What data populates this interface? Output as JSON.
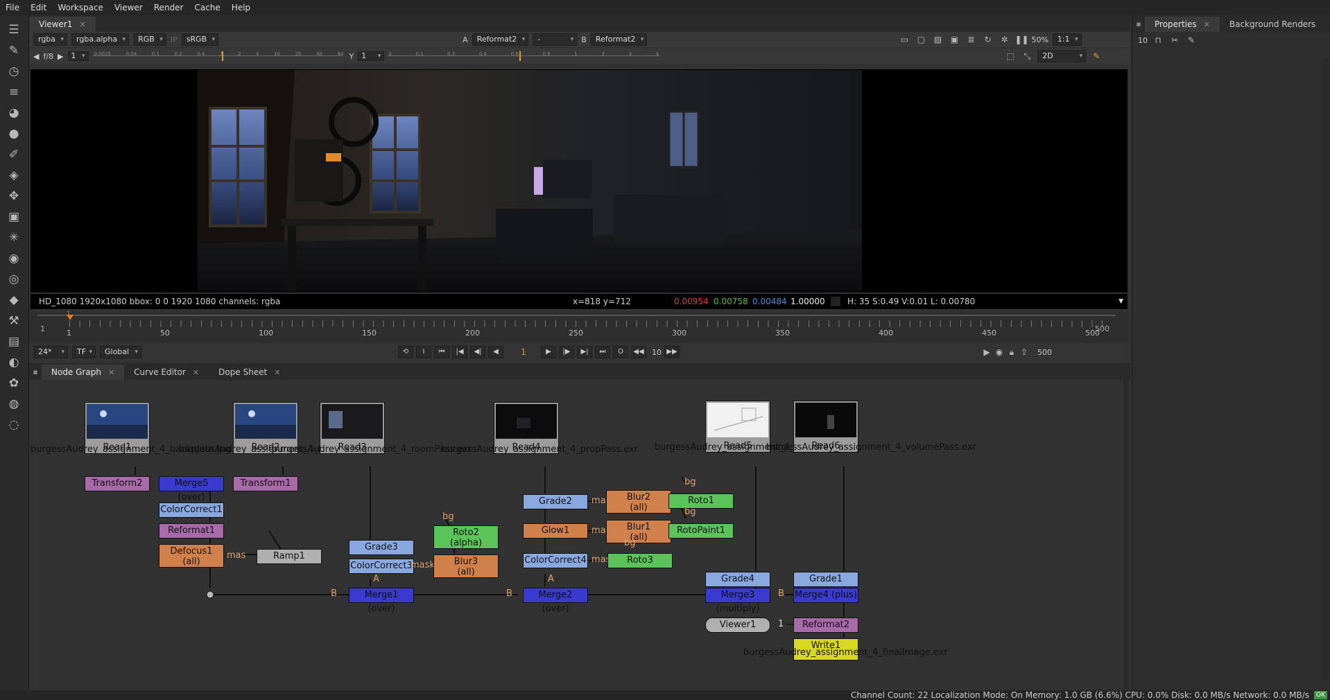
{
  "menu": [
    "File",
    "Edit",
    "Workspace",
    "Viewer",
    "Render",
    "Cache",
    "Help"
  ],
  "toolbar_icons": [
    "viewer-icon",
    "paint-icon",
    "time-icon",
    "channel-icon",
    "color-icon",
    "filter-icon",
    "draw-icon",
    "layers-icon",
    "transform-icon",
    "3d-icon",
    "particles-icon",
    "deep-icon",
    "views-icon",
    "metadata-icon",
    "toolsets-icon",
    "other-icon",
    "furnace-icon",
    "ocula-icon",
    "cara-icon",
    "ofx-icon",
    "nukex-icon"
  ],
  "viewer": {
    "tab": "Viewer1",
    "row1": {
      "layer": "rgba",
      "channel": "rgba.alpha",
      "display": "RGB",
      "ip": "IP",
      "lut": "sRGB",
      "a_label": "A",
      "a_input": "Reformat2",
      "a_op": "-",
      "b_label": "B",
      "b_input": "Reformat2",
      "zoom": "50%",
      "ratio": "1:1"
    },
    "row2": {
      "fstop": "f/8",
      "gain": "1",
      "y_label": "Y",
      "gamma": "1",
      "mode": "2D",
      "gain_ticks": [
        "0.0025",
        "0.04",
        "0.1",
        "0.2",
        "0.4",
        "1",
        "2",
        "4",
        "10",
        "20",
        "40",
        "64"
      ],
      "gamma_ticks": [
        "0",
        "0.1",
        "0.2",
        "0.4",
        "0.6",
        "0.8",
        "1",
        "2",
        "3",
        "4"
      ]
    },
    "info_left": "HD_1080 1920x1080  bbox: 0 0 1920 1080 channels: rgba",
    "info_coords": "x=818 y=712",
    "info_r": "0.00954",
    "info_g": "0.00758",
    "info_b": "0.00484",
    "info_a": "1.00000",
    "info_hsv": "H: 35 S:0.49 V:0.01  L: 0.00780",
    "colors": {
      "r": "#e04040",
      "g": "#60c040",
      "b": "#5090e0",
      "a": "#eeeeee"
    }
  },
  "timeline": {
    "start": "1",
    "end": "500",
    "ticks": [
      "1",
      "50",
      "100",
      "150",
      "200",
      "250",
      "300",
      "350",
      "400",
      "450",
      "500"
    ],
    "current_marker": "1"
  },
  "playbar": {
    "fps": "24*",
    "tf": "TF",
    "scope": "Global",
    "frame": "1",
    "step": "10",
    "end_frame": "500"
  },
  "nodegraph": {
    "tabs": [
      "Node Graph",
      "Curve Editor",
      "Dope Sheet"
    ],
    "reads": [
      {
        "name": "Read1",
        "file": "burgessAudrey_assignment_4_backplate.jpg"
      },
      {
        "name": "Read2",
        "file": "burgessAudrey_assignment_4_backplate.jpg"
      },
      {
        "name": "Read3",
        "file": "burgessAudrey_assignment_4_roomPass.exr"
      },
      {
        "name": "Read4",
        "file": "burgessAudrey_assignment_4_propPass.exr"
      },
      {
        "name": "Read5",
        "file": "burgessAudrey_assignment_4_AOPass.exr"
      },
      {
        "name": "Read6",
        "file": "burgessAudrey_assignment_4_volumePass.exr"
      }
    ],
    "nodes": {
      "transform2": "Transform2",
      "merge5": "Merge5 (over)",
      "transform1": "Transform1",
      "colorcorrect1": "ColorCorrect1",
      "reformat1": "Reformat1",
      "defocus1_a": "Defocus1",
      "defocus1_b": "(all)",
      "ramp1": "Ramp1",
      "grade3": "Grade3",
      "colorcorrect3": "ColorCorrect3",
      "roto2_a": "Roto2",
      "roto2_b": "(alpha)",
      "blur3_a": "Blur3",
      "blur3_b": "(all)",
      "merge1": "Merge1 (over)",
      "grade2": "Grade2",
      "glow1": "Glow1",
      "colorcorrect4": "ColorCorrect4",
      "blur2_a": "Blur2",
      "blur2_b": "(all)",
      "blur1_a": "Blur1",
      "blur1_b": "(all)",
      "roto1": "Roto1",
      "rotopaint1": "RotoPaint1",
      "roto3": "Roto3",
      "merge2": "Merge2 (over)",
      "grade4": "Grade4",
      "merge3": "Merge3 (multiply)",
      "grade1": "Grade1",
      "merge4": "Merge4 (plus)",
      "viewer1": "Viewer1",
      "viewer_input": "1",
      "reformat2": "Reformat2",
      "write1": "Write1",
      "write_file": "burgessAudrey_assignment_4_finalImage.exr"
    },
    "labels": {
      "b": "B",
      "a": "A",
      "mask": "mask",
      "mas": "mas",
      "bg": "bg"
    },
    "colors": {
      "read": "#9c9c9c",
      "transform": "#a86aa8",
      "merge": "#3a3ad0",
      "color": "#8aa8e0",
      "filter": "#d0804a",
      "draw": "#5ac45a",
      "viewer": "#b0b0b0",
      "write": "#d8d820"
    }
  },
  "right": {
    "tabs": [
      "Properties",
      "Background Renders"
    ],
    "max_panels": "10"
  },
  "status": "Channel Count: 22  Localization Mode: On  Memory: 1.0 GB (6.6%)  CPU: 0.0%  Disk: 0.0 MB/s  Network: 0.0 MB/s",
  "status_ok": "OK"
}
